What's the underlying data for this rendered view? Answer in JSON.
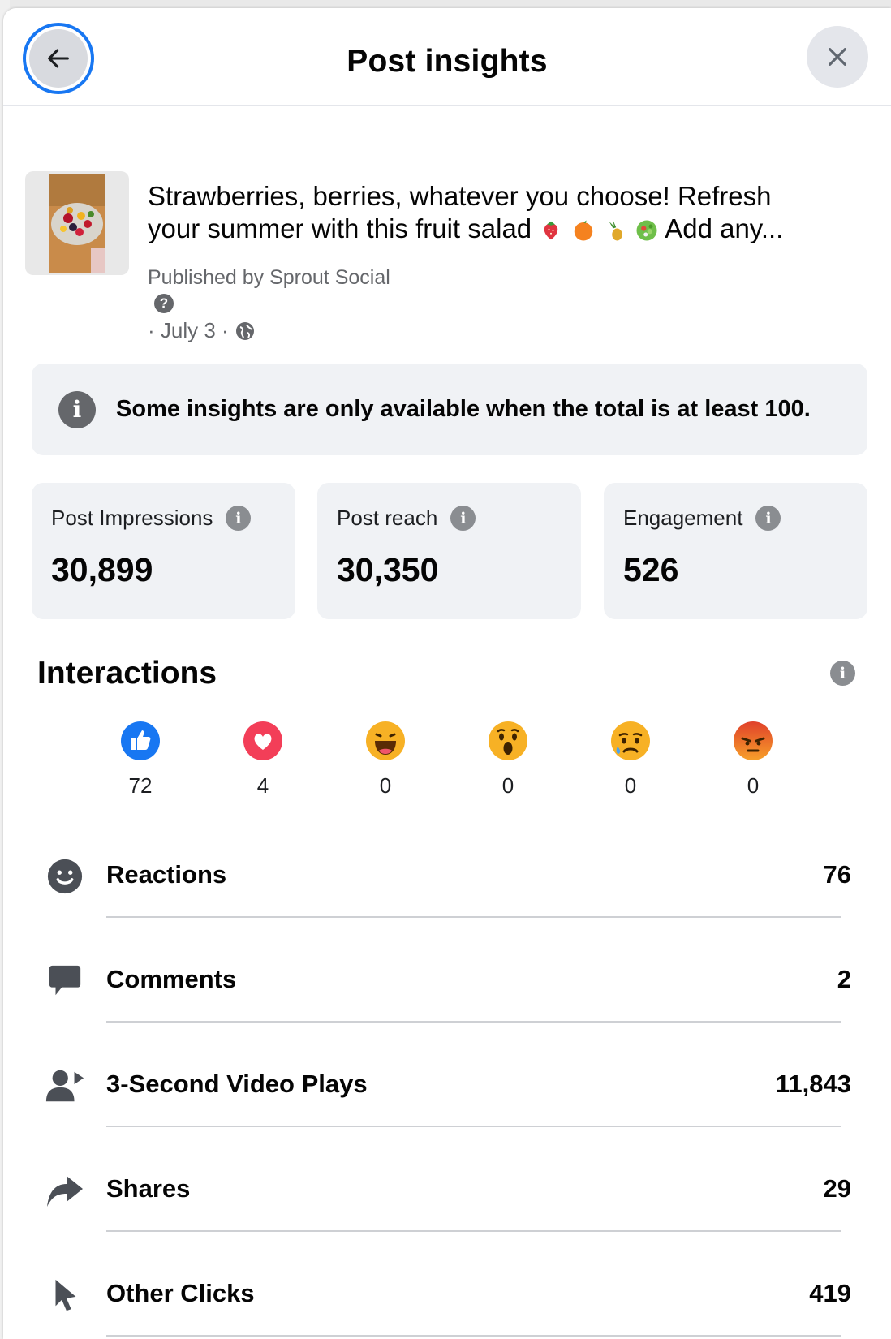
{
  "header": {
    "title": "Post insights",
    "back_icon": "arrow-left-icon",
    "close_icon": "close-icon"
  },
  "post": {
    "text_line1": "Strawberries, berries, whatever you choose! Refresh",
    "text_line2_start": "your summer with this fruit salad",
    "text_line2_end": "Add any...",
    "emojis": [
      "🍓",
      "🍊",
      "🍍",
      "🥗"
    ],
    "published_by": "Published by Sprout Social",
    "date": "· July 3 ·",
    "privacy_icon": "globe-icon"
  },
  "banner": {
    "message": "Some insights are only available when the total is at least 100."
  },
  "metrics": [
    {
      "label": "Post Impressions",
      "value": "30,899"
    },
    {
      "label": "Post reach",
      "value": "30,350"
    },
    {
      "label": "Engagement",
      "value": "526"
    }
  ],
  "interactions": {
    "title": "Interactions",
    "reactions": [
      {
        "name": "like",
        "count": "72",
        "color": "#1877f2"
      },
      {
        "name": "love",
        "count": "4",
        "color": "#f33e58"
      },
      {
        "name": "haha",
        "count": "0",
        "color": "#f7b125"
      },
      {
        "name": "wow",
        "count": "0",
        "color": "#f7b125"
      },
      {
        "name": "sad",
        "count": "0",
        "color": "#f7b125"
      },
      {
        "name": "angry",
        "count": "0",
        "color": "#e9710f"
      }
    ],
    "rows": [
      {
        "label": "Reactions",
        "value": "76",
        "icon": "smiley-icon"
      },
      {
        "label": "Comments",
        "value": "2",
        "icon": "comment-icon"
      },
      {
        "label": "3-Second Video Plays",
        "value": "11,843",
        "icon": "video-viewer-icon"
      },
      {
        "label": "Shares",
        "value": "29",
        "icon": "share-arrow-icon"
      },
      {
        "label": "Other Clicks",
        "value": "419",
        "icon": "cursor-icon"
      }
    ]
  },
  "colors": {
    "accent": "#1877f2",
    "card_bg": "#f0f2f5",
    "secondary_text": "#65676b"
  }
}
